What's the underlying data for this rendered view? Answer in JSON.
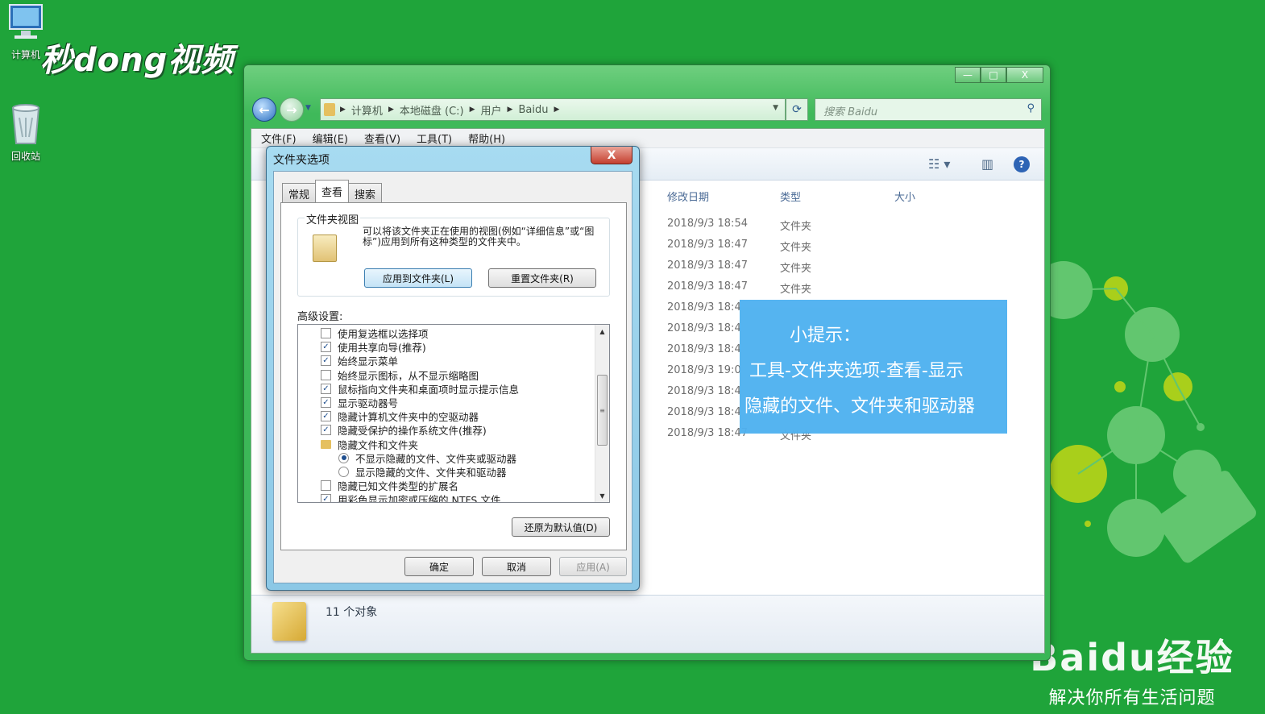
{
  "desktop": {
    "icons": [
      {
        "label": "计算机"
      },
      {
        "label": "回收站"
      }
    ],
    "watermark": "秒dong视频",
    "baidu": {
      "logo": "Baidu经验",
      "slogan": "解决你所有生活问题"
    }
  },
  "explorer": {
    "window_buttons": {
      "minimize": "—",
      "maximize": "□",
      "close": "X"
    },
    "breadcrumb": [
      "计算机",
      "本地磁盘 (C:)",
      "用户",
      "Baidu"
    ],
    "search_placeholder": "搜索 Baidu",
    "menu": [
      "文件(F)",
      "编辑(E)",
      "查看(V)",
      "工具(T)",
      "帮助(H)"
    ],
    "columns": {
      "date": "修改日期",
      "type": "类型",
      "size": "大小"
    },
    "rows": [
      {
        "date": "2018/9/3 18:54",
        "type": "文件夹"
      },
      {
        "date": "2018/9/3 18:47",
        "type": "文件夹"
      },
      {
        "date": "2018/9/3 18:47",
        "type": "文件夹"
      },
      {
        "date": "2018/9/3 18:47",
        "type": "文件夹"
      },
      {
        "date": "2018/9/3 18:4",
        "type": ""
      },
      {
        "date": "2018/9/3 18:4",
        "type": ""
      },
      {
        "date": "2018/9/3 18:4",
        "type": ""
      },
      {
        "date": "2018/9/3 19:0",
        "type": ""
      },
      {
        "date": "2018/9/3 18:4",
        "type": ""
      },
      {
        "date": "2018/9/3 18:4",
        "type": ""
      },
      {
        "date": "2018/9/3 18:47",
        "type": "文件夹"
      }
    ],
    "status": "11 个对象"
  },
  "tip": {
    "title": "小提示：",
    "line1": "工具-文件夹选项-查看-显示",
    "line2": "隐藏的文件、文件夹和驱动器"
  },
  "dialog": {
    "title": "文件夹选项",
    "close": "X",
    "tabs": [
      "常规",
      "查看",
      "搜索"
    ],
    "active_tab": 1,
    "group_label": "文件夹视图",
    "group_desc": "可以将该文件夹正在使用的视图(例如“详细信息”或“图标”)应用到所有这种类型的文件夹中。",
    "apply_to_folders": "应用到文件夹(L)",
    "reset_folders": "重置文件夹(R)",
    "advanced_label": "高级设置:",
    "settings": [
      {
        "kind": "checkbox",
        "checked": false,
        "label": "使用复选框以选择项"
      },
      {
        "kind": "checkbox",
        "checked": true,
        "label": "使用共享向导(推荐)"
      },
      {
        "kind": "checkbox",
        "checked": true,
        "label": "始终显示菜单"
      },
      {
        "kind": "checkbox",
        "checked": false,
        "label": "始终显示图标，从不显示缩略图"
      },
      {
        "kind": "checkbox",
        "checked": true,
        "label": "鼠标指向文件夹和桌面项时显示提示信息"
      },
      {
        "kind": "checkbox",
        "checked": true,
        "label": "显示驱动器号"
      },
      {
        "kind": "checkbox",
        "checked": true,
        "label": "隐藏计算机文件夹中的空驱动器"
      },
      {
        "kind": "checkbox",
        "checked": true,
        "label": "隐藏受保护的操作系统文件(推荐)"
      },
      {
        "kind": "folder",
        "label": "隐藏文件和文件夹"
      },
      {
        "kind": "radio",
        "checked": true,
        "label": "不显示隐藏的文件、文件夹或驱动器"
      },
      {
        "kind": "radio",
        "checked": false,
        "label": "显示隐藏的文件、文件夹和驱动器"
      },
      {
        "kind": "checkbox",
        "checked": false,
        "label": "隐藏已知文件类型的扩展名"
      },
      {
        "kind": "checkbox",
        "checked": true,
        "label": "用彩色显示加密或压缩的 NTFS 文件"
      }
    ],
    "restore_defaults": "还原为默认值(D)",
    "ok": "确定",
    "cancel": "取消",
    "apply": "应用(A)"
  }
}
